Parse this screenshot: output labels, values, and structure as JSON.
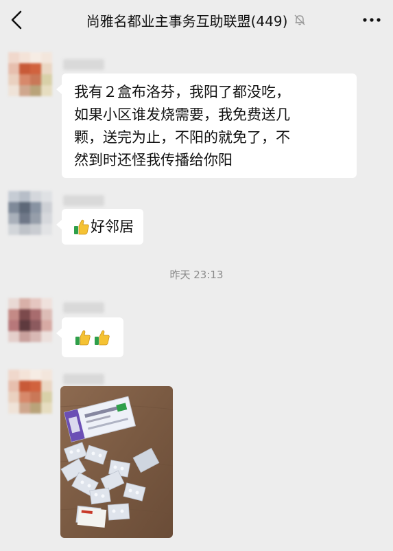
{
  "header": {
    "title": "尚雅名都业主事务互助联盟(449)",
    "back_icon": "chevron-left-icon",
    "mute_icon": "bell-off-icon",
    "more_icon": "more-dots-icon"
  },
  "messages": [
    {
      "type": "text",
      "lines": [
        "我有２盒布洛芬，我阳了都没吃，",
        "如果小区谁发烧需要，我免费送几",
        "颗，送完为止，不阳的就免了，不",
        "然到时还怪我传播给你阳"
      ]
    },
    {
      "type": "text",
      "emoji": "thumbs-up",
      "text": "好邻居"
    },
    {
      "type": "emoji",
      "emojis": [
        "thumbs-up",
        "thumbs-up"
      ]
    },
    {
      "type": "image",
      "content": "photo of ibuprofen medicine box and blister packs"
    }
  ],
  "timestamp": "昨天 23:13",
  "colors": {
    "background": "#ededed",
    "bubble": "#ffffff",
    "timestamp_text": "#8a8a8a"
  }
}
